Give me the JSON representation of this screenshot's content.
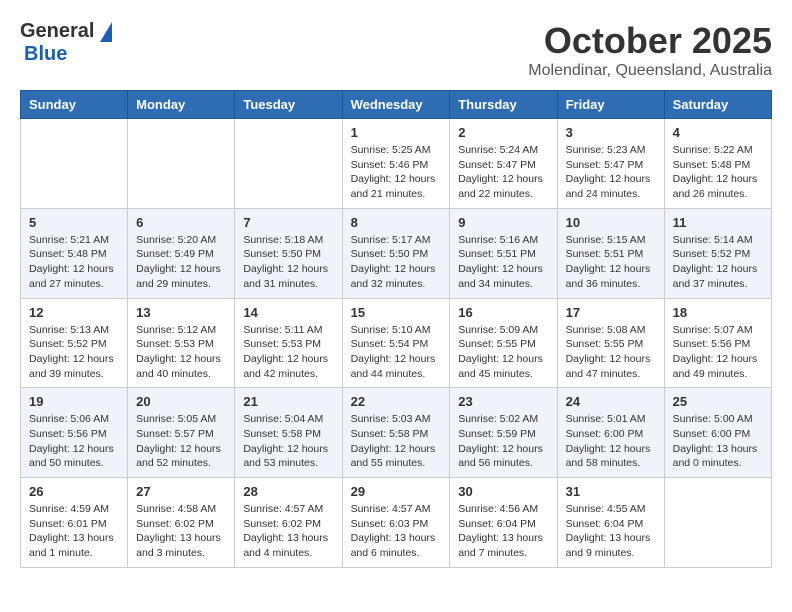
{
  "header": {
    "logo": {
      "general": "General",
      "blue": "Blue"
    },
    "title": "October 2025",
    "location": "Molendinar, Queensland, Australia"
  },
  "calendar": {
    "headers": [
      "Sunday",
      "Monday",
      "Tuesday",
      "Wednesday",
      "Thursday",
      "Friday",
      "Saturday"
    ],
    "weeks": [
      [
        {
          "day": "",
          "info": ""
        },
        {
          "day": "",
          "info": ""
        },
        {
          "day": "",
          "info": ""
        },
        {
          "day": "1",
          "info": "Sunrise: 5:25 AM\nSunset: 5:46 PM\nDaylight: 12 hours\nand 21 minutes."
        },
        {
          "day": "2",
          "info": "Sunrise: 5:24 AM\nSunset: 5:47 PM\nDaylight: 12 hours\nand 22 minutes."
        },
        {
          "day": "3",
          "info": "Sunrise: 5:23 AM\nSunset: 5:47 PM\nDaylight: 12 hours\nand 24 minutes."
        },
        {
          "day": "4",
          "info": "Sunrise: 5:22 AM\nSunset: 5:48 PM\nDaylight: 12 hours\nand 26 minutes."
        }
      ],
      [
        {
          "day": "5",
          "info": "Sunrise: 5:21 AM\nSunset: 5:48 PM\nDaylight: 12 hours\nand 27 minutes."
        },
        {
          "day": "6",
          "info": "Sunrise: 5:20 AM\nSunset: 5:49 PM\nDaylight: 12 hours\nand 29 minutes."
        },
        {
          "day": "7",
          "info": "Sunrise: 5:18 AM\nSunset: 5:50 PM\nDaylight: 12 hours\nand 31 minutes."
        },
        {
          "day": "8",
          "info": "Sunrise: 5:17 AM\nSunset: 5:50 PM\nDaylight: 12 hours\nand 32 minutes."
        },
        {
          "day": "9",
          "info": "Sunrise: 5:16 AM\nSunset: 5:51 PM\nDaylight: 12 hours\nand 34 minutes."
        },
        {
          "day": "10",
          "info": "Sunrise: 5:15 AM\nSunset: 5:51 PM\nDaylight: 12 hours\nand 36 minutes."
        },
        {
          "day": "11",
          "info": "Sunrise: 5:14 AM\nSunset: 5:52 PM\nDaylight: 12 hours\nand 37 minutes."
        }
      ],
      [
        {
          "day": "12",
          "info": "Sunrise: 5:13 AM\nSunset: 5:52 PM\nDaylight: 12 hours\nand 39 minutes."
        },
        {
          "day": "13",
          "info": "Sunrise: 5:12 AM\nSunset: 5:53 PM\nDaylight: 12 hours\nand 40 minutes."
        },
        {
          "day": "14",
          "info": "Sunrise: 5:11 AM\nSunset: 5:53 PM\nDaylight: 12 hours\nand 42 minutes."
        },
        {
          "day": "15",
          "info": "Sunrise: 5:10 AM\nSunset: 5:54 PM\nDaylight: 12 hours\nand 44 minutes."
        },
        {
          "day": "16",
          "info": "Sunrise: 5:09 AM\nSunset: 5:55 PM\nDaylight: 12 hours\nand 45 minutes."
        },
        {
          "day": "17",
          "info": "Sunrise: 5:08 AM\nSunset: 5:55 PM\nDaylight: 12 hours\nand 47 minutes."
        },
        {
          "day": "18",
          "info": "Sunrise: 5:07 AM\nSunset: 5:56 PM\nDaylight: 12 hours\nand 49 minutes."
        }
      ],
      [
        {
          "day": "19",
          "info": "Sunrise: 5:06 AM\nSunset: 5:56 PM\nDaylight: 12 hours\nand 50 minutes."
        },
        {
          "day": "20",
          "info": "Sunrise: 5:05 AM\nSunset: 5:57 PM\nDaylight: 12 hours\nand 52 minutes."
        },
        {
          "day": "21",
          "info": "Sunrise: 5:04 AM\nSunset: 5:58 PM\nDaylight: 12 hours\nand 53 minutes."
        },
        {
          "day": "22",
          "info": "Sunrise: 5:03 AM\nSunset: 5:58 PM\nDaylight: 12 hours\nand 55 minutes."
        },
        {
          "day": "23",
          "info": "Sunrise: 5:02 AM\nSunset: 5:59 PM\nDaylight: 12 hours\nand 56 minutes."
        },
        {
          "day": "24",
          "info": "Sunrise: 5:01 AM\nSunset: 6:00 PM\nDaylight: 12 hours\nand 58 minutes."
        },
        {
          "day": "25",
          "info": "Sunrise: 5:00 AM\nSunset: 6:00 PM\nDaylight: 13 hours\nand 0 minutes."
        }
      ],
      [
        {
          "day": "26",
          "info": "Sunrise: 4:59 AM\nSunset: 6:01 PM\nDaylight: 13 hours\nand 1 minute."
        },
        {
          "day": "27",
          "info": "Sunrise: 4:58 AM\nSunset: 6:02 PM\nDaylight: 13 hours\nand 3 minutes."
        },
        {
          "day": "28",
          "info": "Sunrise: 4:57 AM\nSunset: 6:02 PM\nDaylight: 13 hours\nand 4 minutes."
        },
        {
          "day": "29",
          "info": "Sunrise: 4:57 AM\nSunset: 6:03 PM\nDaylight: 13 hours\nand 6 minutes."
        },
        {
          "day": "30",
          "info": "Sunrise: 4:56 AM\nSunset: 6:04 PM\nDaylight: 13 hours\nand 7 minutes."
        },
        {
          "day": "31",
          "info": "Sunrise: 4:55 AM\nSunset: 6:04 PM\nDaylight: 13 hours\nand 9 minutes."
        },
        {
          "day": "",
          "info": ""
        }
      ]
    ]
  }
}
